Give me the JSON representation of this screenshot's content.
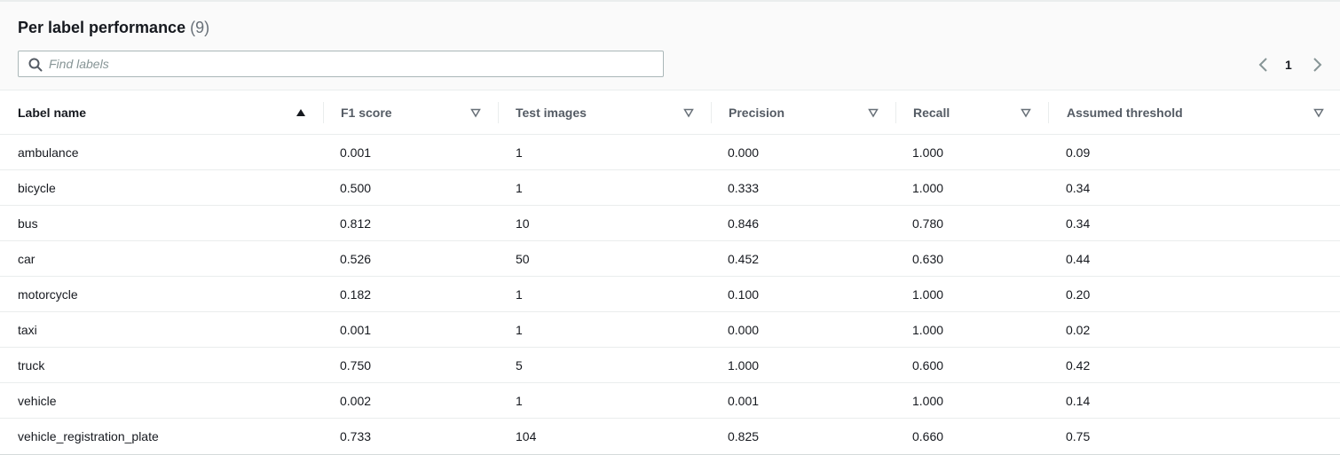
{
  "section": {
    "title": "Per label performance",
    "count": "(9)"
  },
  "search": {
    "placeholder": "Find labels",
    "icon": "search-icon"
  },
  "pagination": {
    "current_page": "1",
    "prev_icon": "chevron-left-icon",
    "next_icon": "chevron-right-icon"
  },
  "table": {
    "columns": [
      {
        "label": "Label name",
        "sort": "ascending"
      },
      {
        "label": "F1 score",
        "sort": "none"
      },
      {
        "label": "Test images",
        "sort": "none"
      },
      {
        "label": "Precision",
        "sort": "none"
      },
      {
        "label": "Recall",
        "sort": "none"
      },
      {
        "label": "Assumed threshold",
        "sort": "none"
      }
    ],
    "rows": [
      [
        "ambulance",
        "0.001",
        "1",
        "0.000",
        "1.000",
        "0.09"
      ],
      [
        "bicycle",
        "0.500",
        "1",
        "0.333",
        "1.000",
        "0.34"
      ],
      [
        "bus",
        "0.812",
        "10",
        "0.846",
        "0.780",
        "0.34"
      ],
      [
        "car",
        "0.526",
        "50",
        "0.452",
        "0.630",
        "0.44"
      ],
      [
        "motorcycle",
        "0.182",
        "1",
        "0.100",
        "1.000",
        "0.20"
      ],
      [
        "taxi",
        "0.001",
        "1",
        "0.000",
        "1.000",
        "0.02"
      ],
      [
        "truck",
        "0.750",
        "5",
        "1.000",
        "0.600",
        "0.42"
      ],
      [
        "vehicle",
        "0.002",
        "1",
        "0.001",
        "1.000",
        "0.14"
      ],
      [
        "vehicle_registration_plate",
        "0.733",
        "104",
        "0.825",
        "0.660",
        "0.75"
      ]
    ]
  },
  "colors": {
    "header_bg": "#fafafa",
    "border": "#eaeded",
    "text": "#16191f",
    "muted_text": "#545b64"
  }
}
